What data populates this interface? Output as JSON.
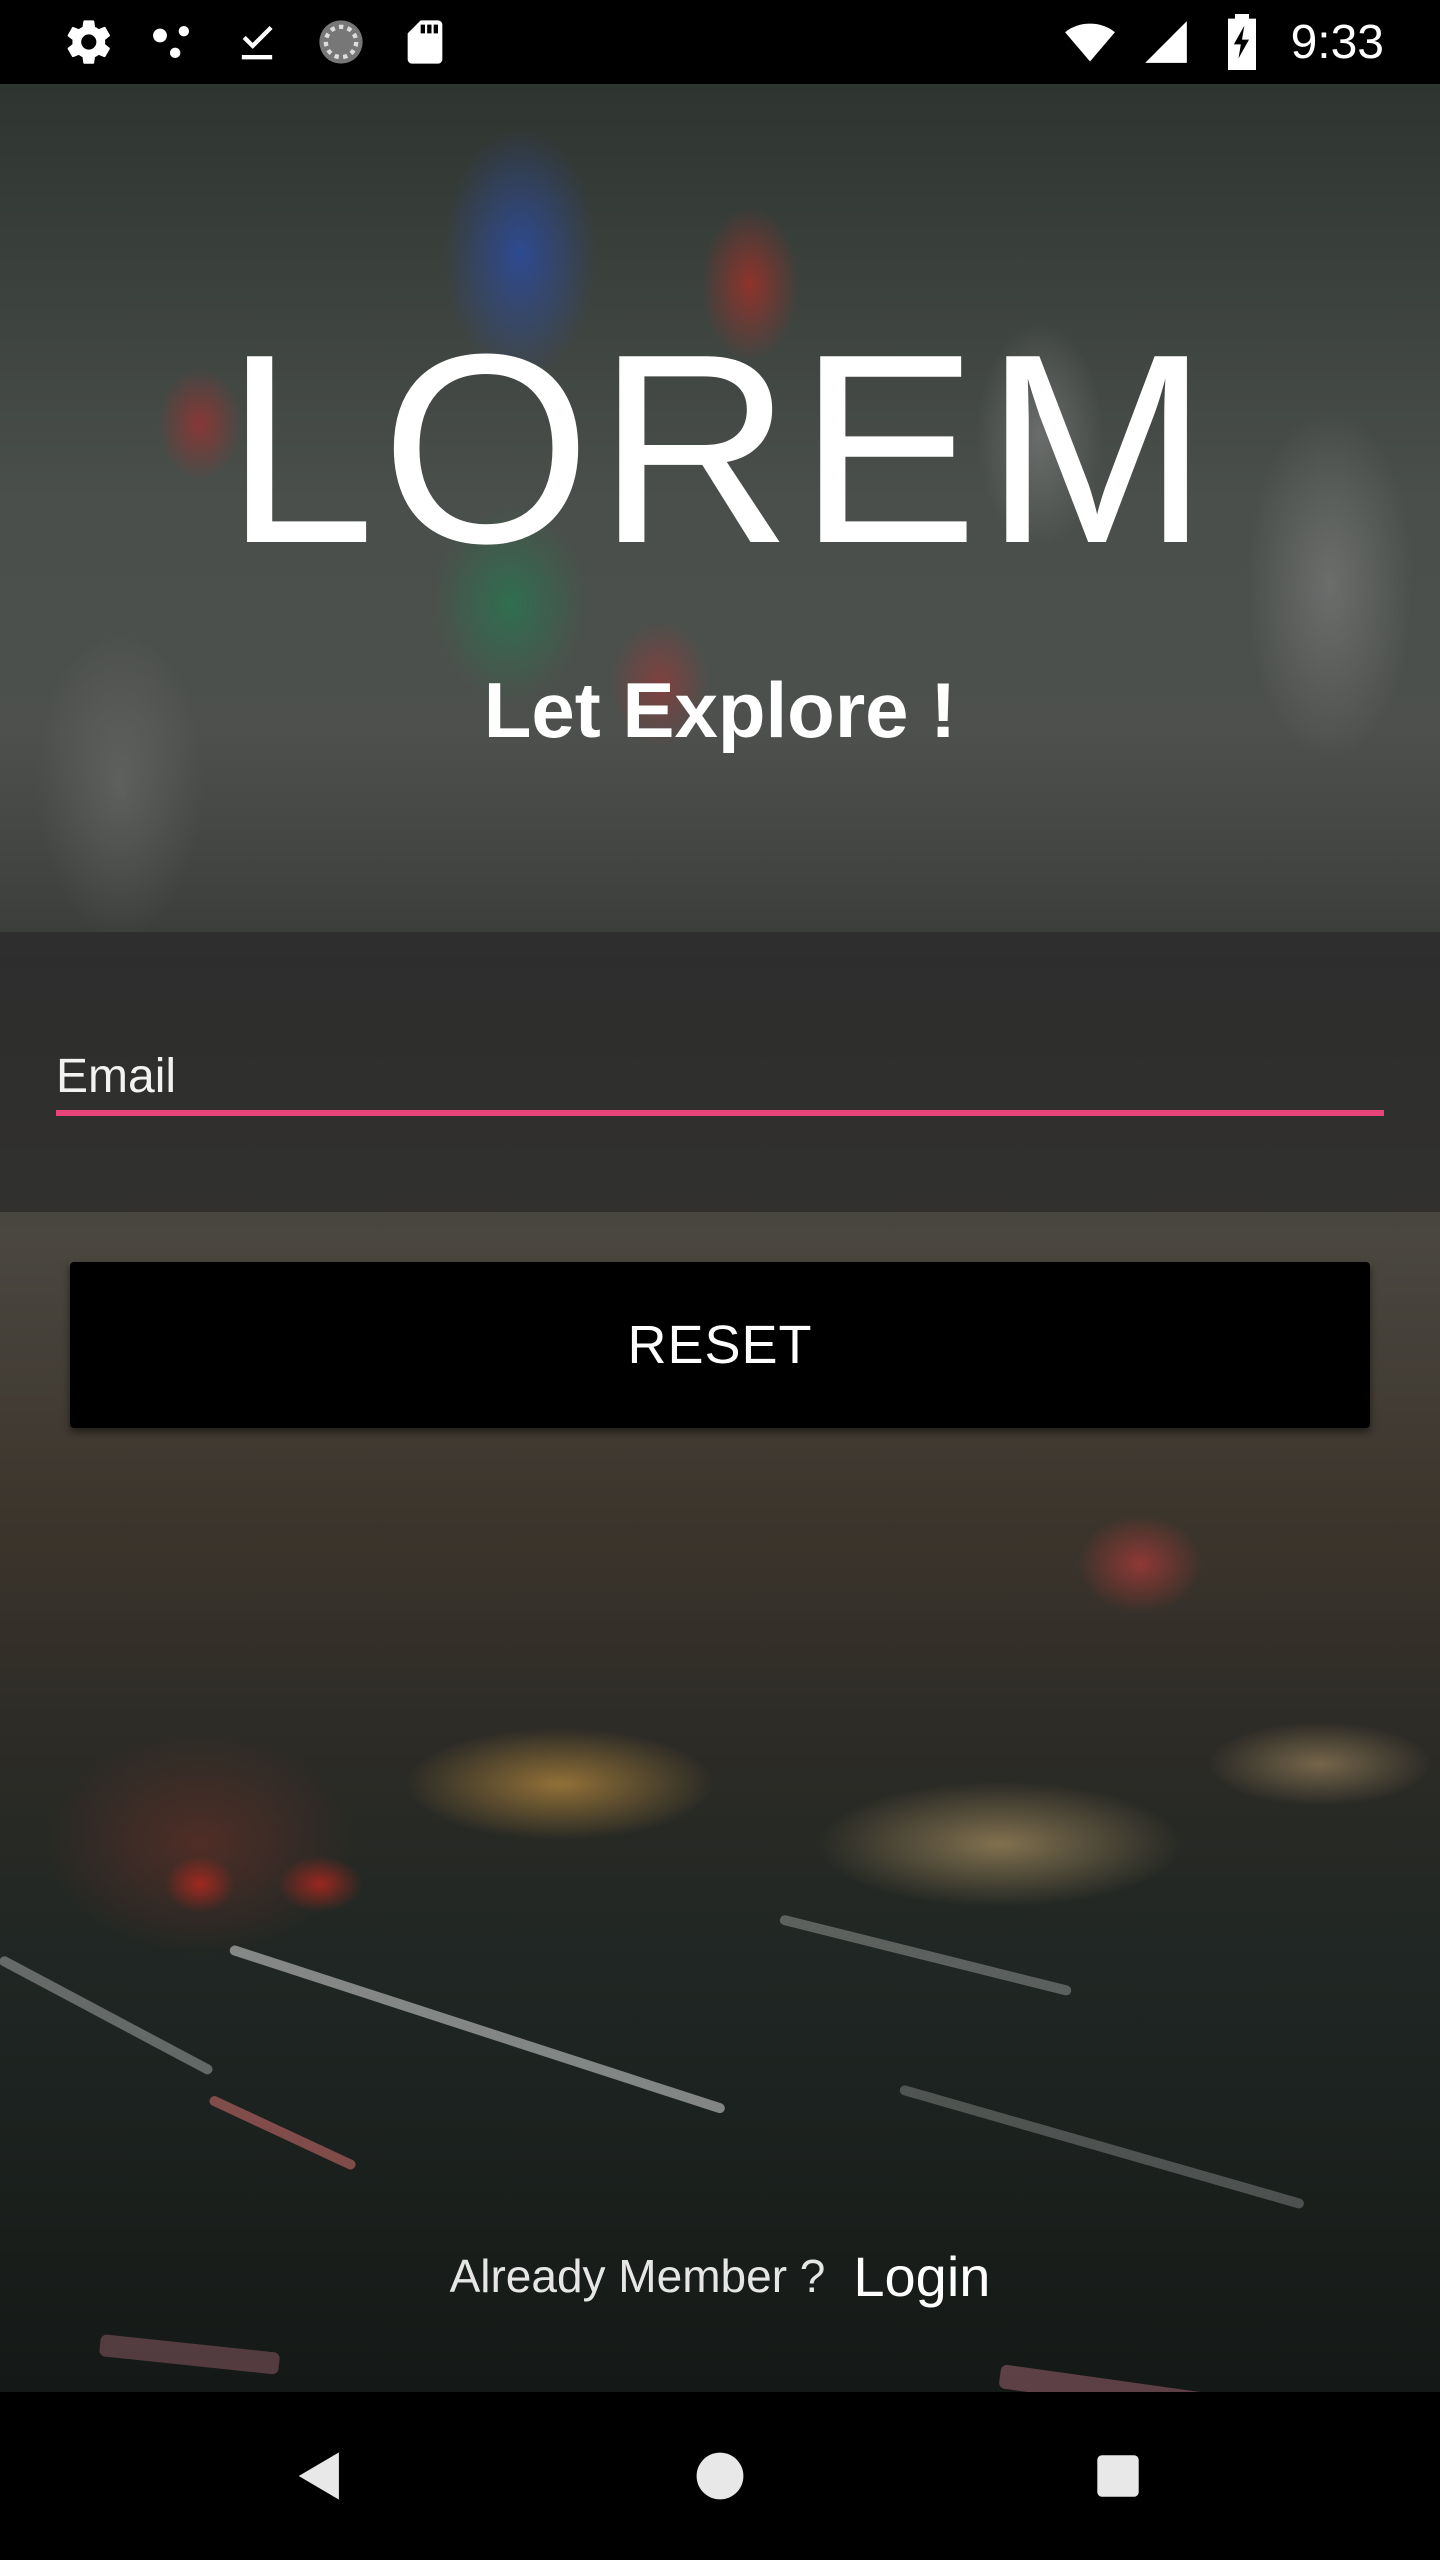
{
  "status_bar": {
    "time": "9:33",
    "left_icons": [
      "settings-icon",
      "share-dots-icon",
      "download-done-icon",
      "sync-circle-icon",
      "sd-card-icon"
    ],
    "right_icons": [
      "wifi-icon",
      "signal-icon",
      "battery-charging-icon"
    ]
  },
  "hero": {
    "title": "LOREM",
    "subtitle": "Let Explore !"
  },
  "form": {
    "email_placeholder": "Email",
    "email_value": "",
    "accent_color": "#e8447a",
    "reset_label": "RESET"
  },
  "footer": {
    "prompt": "Already Member ?",
    "login_label": "Login"
  },
  "nav_bar": {
    "buttons": [
      "back-icon",
      "home-icon",
      "recents-icon"
    ]
  }
}
